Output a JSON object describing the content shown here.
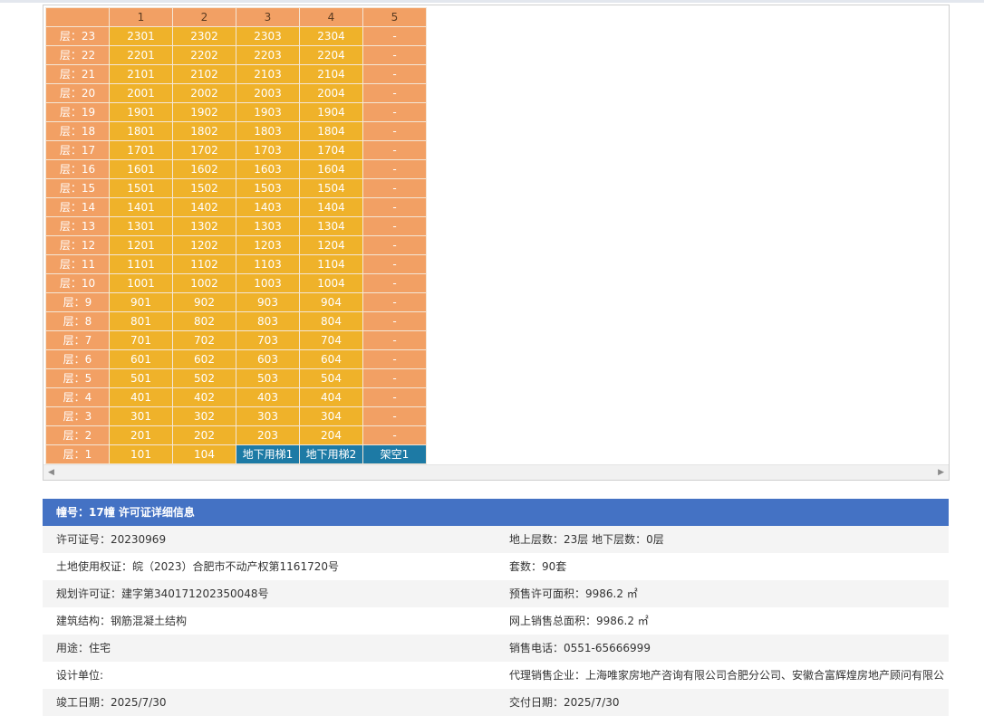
{
  "grid": {
    "columns": [
      "",
      "1",
      "2",
      "3",
      "4",
      "5"
    ],
    "rows": [
      [
        "层：23",
        "2301",
        "2302",
        "2303",
        "2304",
        "-"
      ],
      [
        "层：22",
        "2201",
        "2202",
        "2203",
        "2204",
        "-"
      ],
      [
        "层：21",
        "2101",
        "2102",
        "2103",
        "2104",
        "-"
      ],
      [
        "层：20",
        "2001",
        "2002",
        "2003",
        "2004",
        "-"
      ],
      [
        "层：19",
        "1901",
        "1902",
        "1903",
        "1904",
        "-"
      ],
      [
        "层：18",
        "1801",
        "1802",
        "1803",
        "1804",
        "-"
      ],
      [
        "层：17",
        "1701",
        "1702",
        "1703",
        "1704",
        "-"
      ],
      [
        "层：16",
        "1601",
        "1602",
        "1603",
        "1604",
        "-"
      ],
      [
        "层：15",
        "1501",
        "1502",
        "1503",
        "1504",
        "-"
      ],
      [
        "层：14",
        "1401",
        "1402",
        "1403",
        "1404",
        "-"
      ],
      [
        "层：13",
        "1301",
        "1302",
        "1303",
        "1304",
        "-"
      ],
      [
        "层：12",
        "1201",
        "1202",
        "1203",
        "1204",
        "-"
      ],
      [
        "层：11",
        "1101",
        "1102",
        "1103",
        "1104",
        "-"
      ],
      [
        "层：10",
        "1001",
        "1002",
        "1003",
        "1004",
        "-"
      ],
      [
        "层：9",
        "901",
        "902",
        "903",
        "904",
        "-"
      ],
      [
        "层：8",
        "801",
        "802",
        "803",
        "804",
        "-"
      ],
      [
        "层：7",
        "701",
        "702",
        "703",
        "704",
        "-"
      ],
      [
        "层：6",
        "601",
        "602",
        "603",
        "604",
        "-"
      ],
      [
        "层：5",
        "501",
        "502",
        "503",
        "504",
        "-"
      ],
      [
        "层：4",
        "401",
        "402",
        "403",
        "404",
        "-"
      ],
      [
        "层：3",
        "301",
        "302",
        "303",
        "304",
        "-"
      ],
      [
        "层：2",
        "201",
        "202",
        "203",
        "204",
        "-"
      ],
      [
        "层：1",
        "101",
        "104",
        "地下用梯1",
        "地下用梯2",
        "架空1"
      ]
    ],
    "special_cells": [
      "地下用梯1",
      "地下用梯2",
      "架空1"
    ],
    "colors": {
      "header": "#f2a064",
      "unit": "#efb22a",
      "special": "#1d7aa5"
    }
  },
  "info": {
    "header": "幢号：17幢 许可证详细信息",
    "rows": [
      [
        "许可证号：20230969",
        "地上层数：23层  地下层数：0层"
      ],
      [
        "土地使用权证：皖（2023）合肥市不动产权第1161720号",
        "套数：90套"
      ],
      [
        "规划许可证：建字第340171202350048号",
        "预售许可面积：9986.2 ㎡"
      ],
      [
        "建筑结构：钢筋混凝土结构",
        "网上销售总面积：9986.2 ㎡"
      ],
      [
        "用途：住宅",
        "销售电话：0551-65666999"
      ],
      [
        "设计单位:",
        "代理销售企业：上海唯家房地产咨询有限公司合肥分公司、安徽合富辉煌房地产顾问有限公"
      ],
      [
        "竣工日期：2025/7/30",
        "交付日期：2025/7/30"
      ]
    ]
  },
  "icons": {
    "scroll_left": "arrow-left-icon",
    "scroll_right": "arrow-right-icon"
  }
}
